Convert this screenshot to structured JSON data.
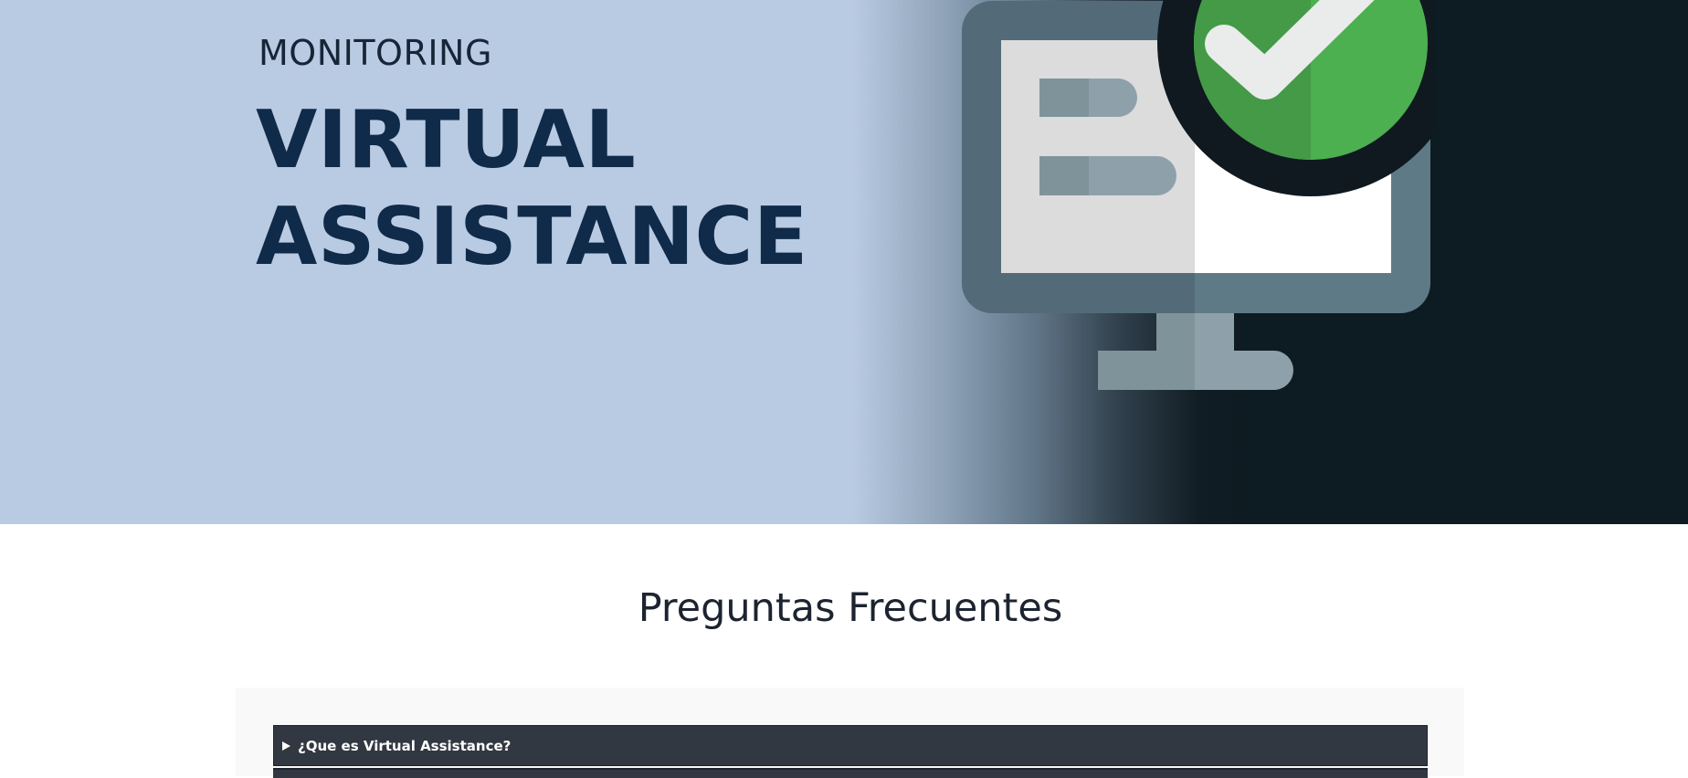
{
  "hero": {
    "kicker": "MONITORING",
    "title_line1": "VIRTUAL",
    "title_line2": "ASSISTANCE",
    "illustration_icon": "monitor-check-icon",
    "colors": {
      "background_light": "#b9cbe2",
      "background_dark": "#0d1b22",
      "title": "#102a4a",
      "check_green": "#4caf50"
    }
  },
  "faq": {
    "heading": "Preguntas Frecuentes",
    "items": [
      {
        "question": "¿Que es Virtual Assistance?",
        "expanded": false,
        "caret_icon": "caret-right-icon"
      }
    ]
  }
}
